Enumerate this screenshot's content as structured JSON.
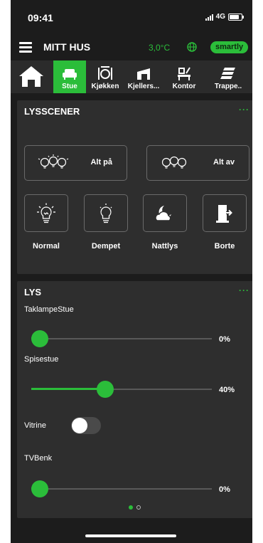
{
  "status_bar": {
    "time": "09:41",
    "network": "4G"
  },
  "header": {
    "title": "MITT HUS",
    "temperature": "3,0°C",
    "brand": "smartly"
  },
  "colors": {
    "accent": "#2bbd3a",
    "background": "#1c1c1c",
    "card": "#2e2e2e"
  },
  "tabs": [
    {
      "icon": "home-icon",
      "label": ""
    },
    {
      "icon": "sofa-icon",
      "label": "Stue",
      "active": true
    },
    {
      "icon": "dining-icon",
      "label": "Kjøkken"
    },
    {
      "icon": "basement-icon",
      "label": "Kjellers..."
    },
    {
      "icon": "desk-icon",
      "label": "Kontor"
    },
    {
      "icon": "stairs-icon",
      "label": "Trappe.."
    }
  ],
  "scenes": {
    "title": "LYSSCENER",
    "more": "···",
    "all_on": "Alt på",
    "all_off": "Alt av",
    "items": [
      {
        "icon": "lightbulb-icon",
        "label": "Normal"
      },
      {
        "icon": "dim-lightbulb-icon",
        "label": "Dempet"
      },
      {
        "icon": "night-cloud-icon",
        "label": "Nattlys"
      },
      {
        "icon": "door-exit-icon",
        "label": "Borte"
      }
    ]
  },
  "lights": {
    "title": "LYS",
    "more": "···",
    "items": [
      {
        "name": "TaklampeStue",
        "type": "slider",
        "value": 0,
        "value_label": "0%"
      },
      {
        "name": "Spisestue",
        "type": "slider",
        "value": 40,
        "value_label": "40%"
      },
      {
        "name": "Vitrine",
        "type": "toggle",
        "on": false
      },
      {
        "name": "TVBenk",
        "type": "slider",
        "value": 0,
        "value_label": "0%"
      }
    ],
    "pager": {
      "pages": 2,
      "current": 1
    }
  }
}
